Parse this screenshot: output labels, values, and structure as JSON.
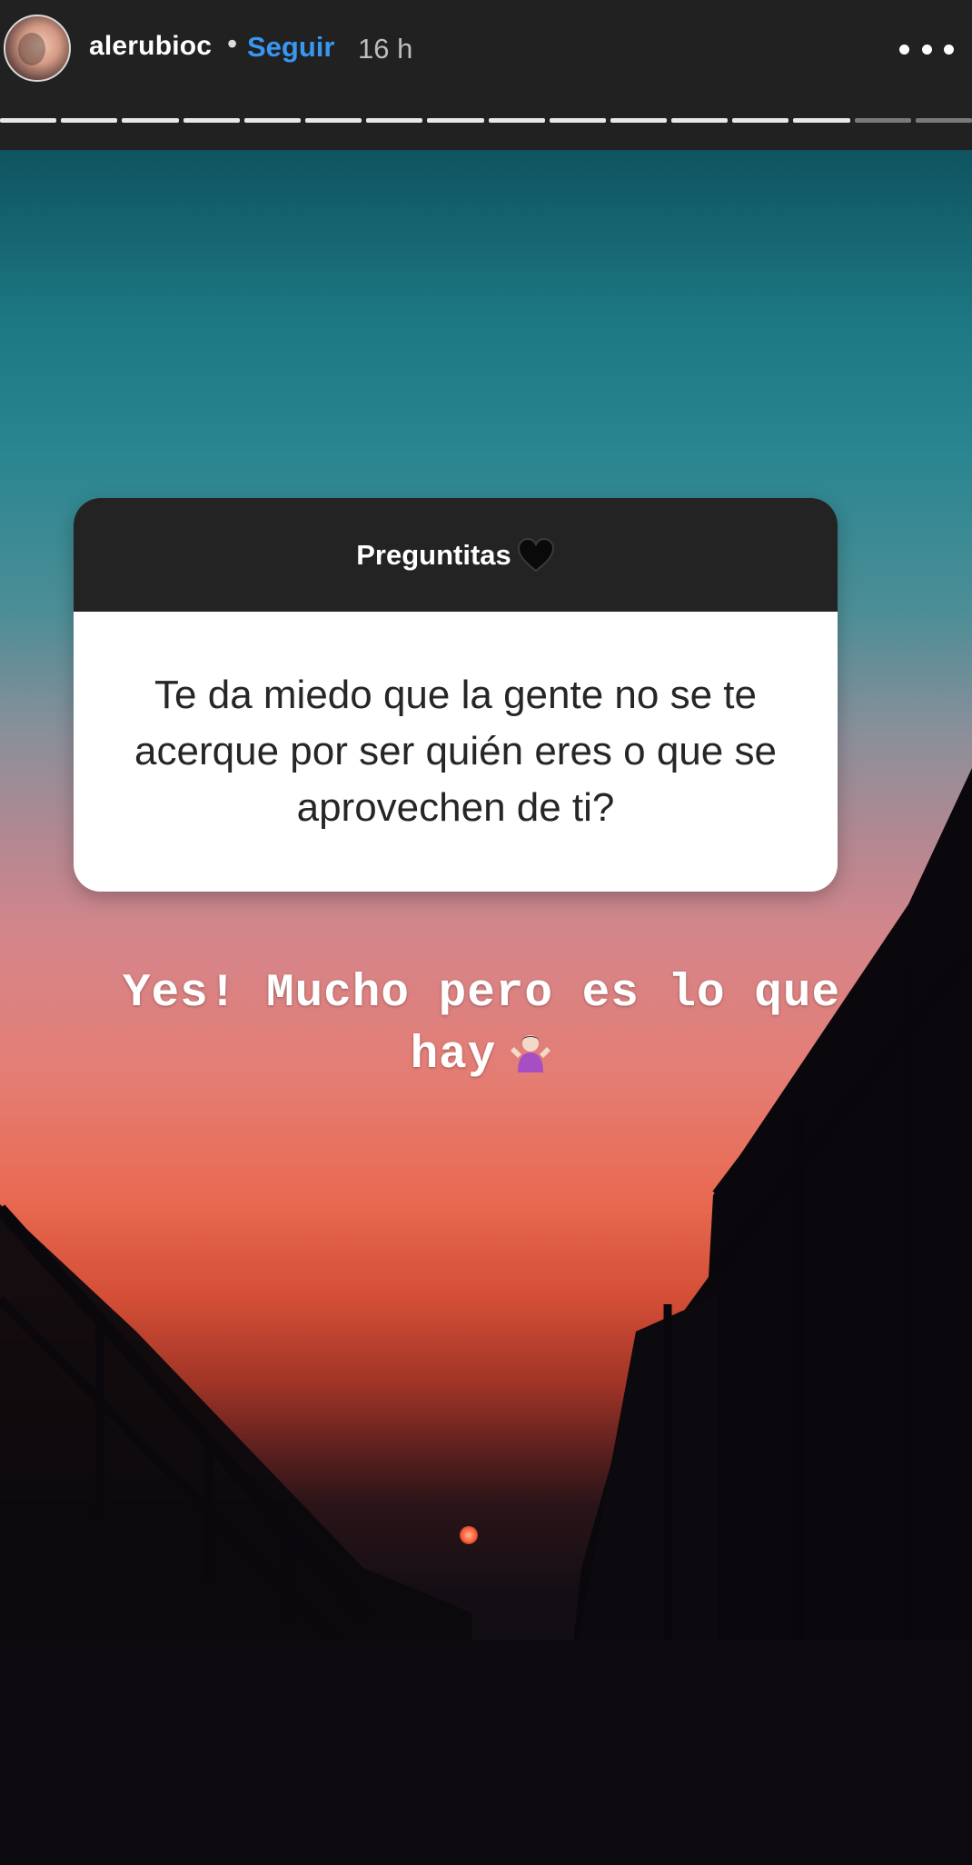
{
  "header": {
    "username": "alerubioc",
    "separator": "•",
    "follow_label": "Seguir",
    "time_ago": "16 h",
    "progress": {
      "total_segments": 16,
      "viewed_segments": 14
    }
  },
  "question_sticker": {
    "title": "Preguntitas",
    "title_emoji": "black-heart-icon",
    "question": "Te da miedo que la gente no se te acerque por ser quién eres o que se aprovechen de ti?"
  },
  "answer": {
    "text": "Yes! Mucho pero es lo que hay",
    "emoji": "person-shrugging-icon"
  },
  "colors": {
    "follow": "#3897f0",
    "header_bg": "#212121",
    "sticker_header_bg": "#232323"
  }
}
